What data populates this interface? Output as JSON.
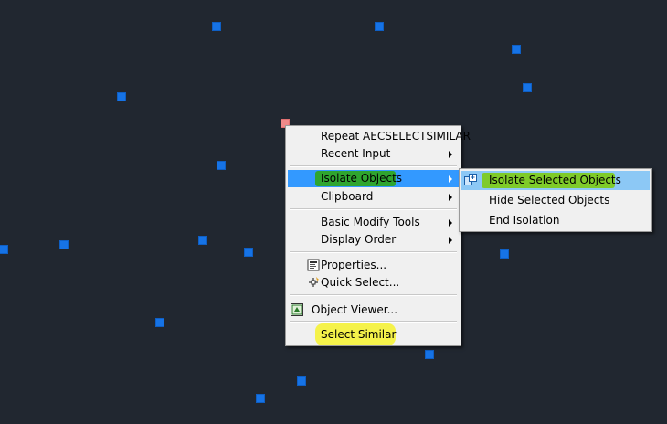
{
  "context_menu": {
    "items": [
      {
        "label": "Repeat AECSELECTSIMILAR"
      },
      {
        "label": "Recent Input"
      },
      {
        "label": "Isolate Objects"
      },
      {
        "label": "Clipboard"
      },
      {
        "label": "Basic Modify Tools"
      },
      {
        "label": "Display Order"
      },
      {
        "label": "Properties..."
      },
      {
        "label": "Quick Select..."
      },
      {
        "label": "Object Viewer..."
      },
      {
        "label": "Select Similar"
      }
    ]
  },
  "submenu": {
    "items": [
      {
        "label": "Isolate Selected Objects"
      },
      {
        "label": "Hide Selected Objects"
      },
      {
        "label": "End Isolation"
      }
    ]
  },
  "colors": {
    "canvas_bg": "#212730",
    "grip": "#1673e6",
    "hover_grip": "#f08a8a",
    "menu_bg": "#f0f0f0",
    "selection": "#3399ff",
    "green_highlight": "#2fa52f",
    "yellow_highlight": "#f5f24a"
  }
}
